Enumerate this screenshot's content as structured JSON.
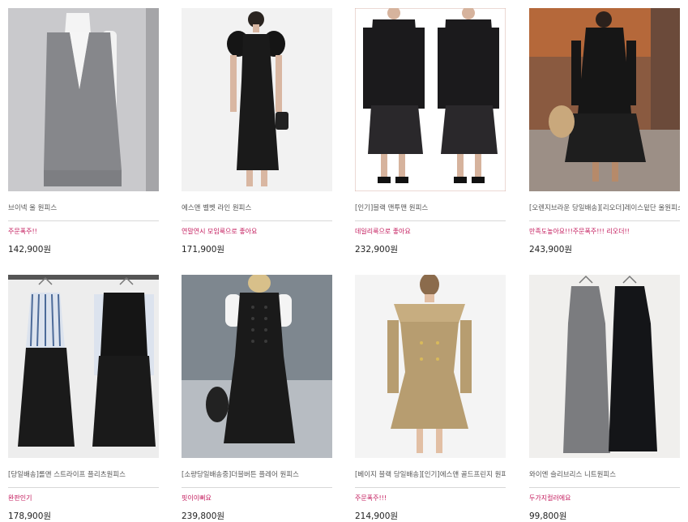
{
  "products": [
    {
      "title": "브이넥 울 원피스",
      "badge": "주문폭주!!",
      "price": "142,900원",
      "image": "gray-v-neck-jumper-dress-over-white-turtleneck"
    },
    {
      "title": "에스앤 벨벳 라인 원피스",
      "badge": "연말연시 모임룩으로 좋아요",
      "price": "171,900원",
      "image": "black-velvet-puff-sleeve-midi-dress"
    },
    {
      "title": "[인기]블랙 맨투맨 원피스",
      "badge": "데일리룩으로 좋아요",
      "price": "232,900원",
      "image": "black-sweatshirt-dress-pleated-hem"
    },
    {
      "title": "[오렌지브라운 당일배송][리오더]레이스밑단 울원피스",
      "badge": "만족도높아요!!!주문폭주!!! 리오더!!",
      "price": "243,900원",
      "image": "black-knit-dress-lace-hem-street"
    },
    {
      "title": "[당일배송]롤앤 스트라이프 플리츠원피스",
      "badge": "완판인기",
      "price": "178,900원",
      "image": "striped-shirt-black-pleated-dress-on-hanger"
    },
    {
      "title": "[소량당일배송중]더블버튼 플레어 원피스",
      "badge": "핏이이뻐요",
      "price": "239,800원",
      "image": "black-double-button-flare-vest-dress"
    },
    {
      "title": "[베이지 블랙 당일배송][인기]에스앤 골드프린지 원피스",
      "badge": "주문폭주!!!",
      "price": "214,900원",
      "image": "beige-tweed-off-shoulder-mini-dress"
    },
    {
      "title": "와이엔 슬리브리스 니트원피스",
      "badge": "두가지컬러에요",
      "price": "99,800원",
      "image": "gray-and-black-sleeveless-knit-dresses-on-hangers"
    }
  ]
}
